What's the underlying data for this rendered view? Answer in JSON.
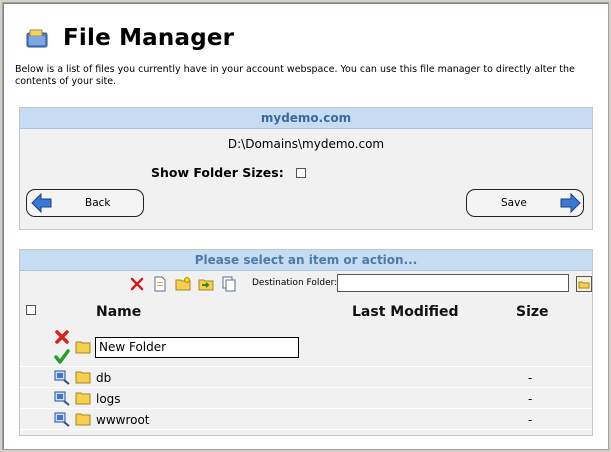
{
  "page": {
    "title": "File Manager",
    "icon": "folder-briefcase-icon"
  },
  "intro": "Below is a list of files you currently have in your account webspace. You can use this file manager to directly alter the contents of your site.",
  "site_panel": {
    "heading": "mydemo.com",
    "path": "D:\\Domains\\mydemo.com",
    "show_sizes_label": "Show Folder Sizes:",
    "show_sizes_checked": false,
    "back_label": "Back",
    "save_label": "Save"
  },
  "action_panel": {
    "heading": "Please select an item or action...",
    "toolbar_icons": [
      "delete-icon",
      "new-file-icon",
      "new-folder-icon",
      "move-icon",
      "copy-icon"
    ],
    "destination_label": "Destination Folder:",
    "destination_value": "",
    "destination_browse_icon": "folder-browse-icon"
  },
  "table": {
    "headers": {
      "name": "Name",
      "modified": "Last Modified",
      "size": "Size"
    },
    "new_folder": {
      "value": "New Folder",
      "cancel_icon": "red-x-icon",
      "confirm_icon": "green-check-icon"
    },
    "rows": [
      {
        "name": "db",
        "modified": "",
        "size": "-"
      },
      {
        "name": "logs",
        "modified": "",
        "size": "-"
      },
      {
        "name": "wwwroot",
        "modified": "",
        "size": "-"
      }
    ]
  },
  "colors": {
    "panel_head": "#c6dcf2",
    "panel_head_text": "#3a6a9a",
    "panel_bg": "#f1f1f1"
  }
}
